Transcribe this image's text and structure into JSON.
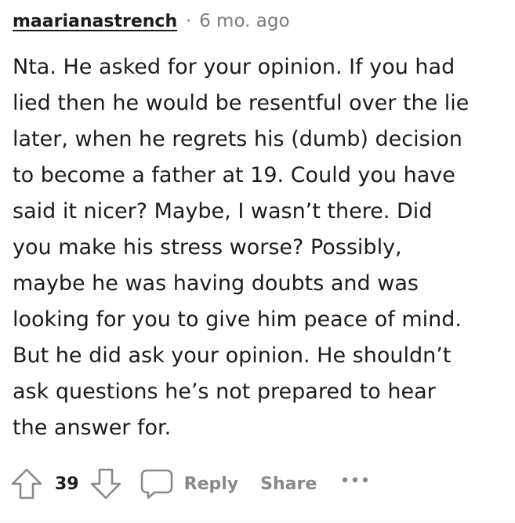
{
  "comment": {
    "author": "maarianastrench",
    "separator": "·",
    "timestamp": "6 mo. ago",
    "body_lines": [
      "Nta. He asked for your opinion. If you had",
      "lied then he would be resentful over the lie",
      "later, when he regrets his (dumb) decision",
      "to become a father at 19. Could you have",
      "said it nicer? Maybe, I wasn’t there. Did",
      "you make his stress worse? Possibly,",
      "maybe he was having doubts and was",
      "looking for you to give him peace of mind.",
      "But he did ask your opinion. He shouldn’t",
      "ask questions he’s not prepared to hear",
      "the answer for."
    ]
  },
  "actions": {
    "upvote_icon": "upvote-arrow-icon",
    "score": "39",
    "downvote_icon": "downvote-arrow-icon",
    "reply_icon": "speech-bubble-icon",
    "reply_label": "Reply",
    "share_label": "Share",
    "more_icon": "more-options-icon"
  },
  "colors": {
    "text": "#1c1c1c",
    "muted": "#7c7c7c",
    "action_gray": "#878a8c",
    "icon_gray": "#878a8c",
    "divider": "#edeff1"
  }
}
